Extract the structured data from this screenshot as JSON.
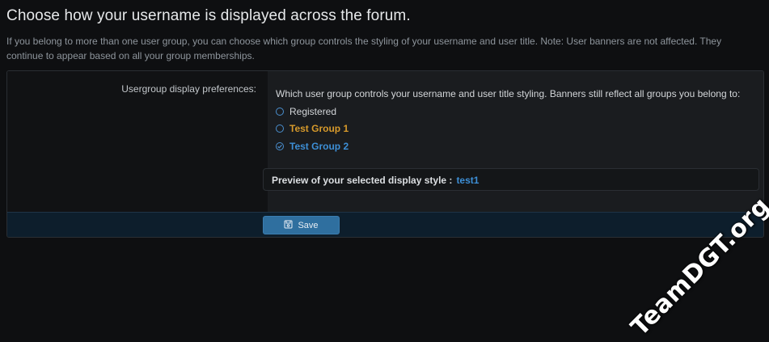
{
  "page": {
    "title": "Choose how your username is displayed across the forum.",
    "intro": "If you belong to more than one user group, you can choose which group controls the styling of your username and user title. Note: User banners are not affected. They continue to appear based on all your group memberships."
  },
  "form": {
    "label": "Usergroup display preferences:",
    "explain": "Which user group controls your username and user title styling. Banners still reflect all groups you belong to:",
    "options": [
      {
        "label": "Registered",
        "checked": false,
        "color": "#d3d6d9"
      },
      {
        "label": "Test Group 1",
        "checked": false,
        "color": "#d79a2b"
      },
      {
        "label": "Test Group 2",
        "checked": true,
        "color": "#3d8fd6"
      }
    ],
    "preview_label": "Preview of your selected display style :",
    "preview_value": "test1"
  },
  "footer": {
    "save_label": "Save",
    "save_icon": "save-icon"
  },
  "watermark": "TeamDGT.org"
}
